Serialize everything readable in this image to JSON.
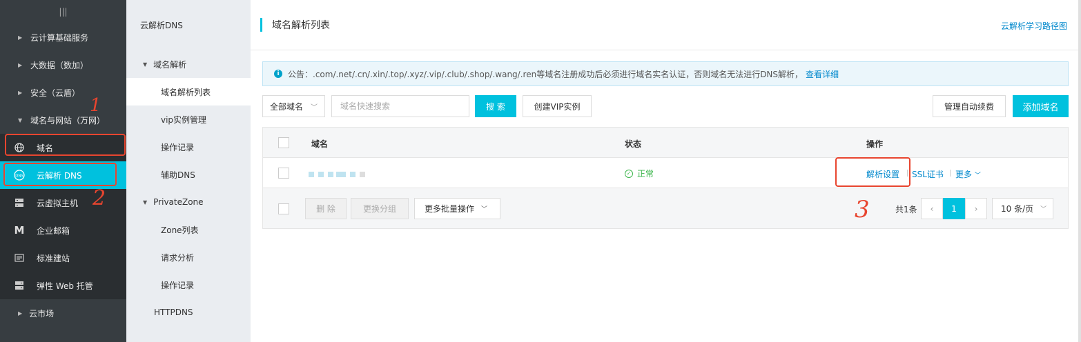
{
  "nav": {
    "top_icon": "|||",
    "groups": [
      {
        "label": "云计算基础服务"
      },
      {
        "label": "大数据（数加）"
      },
      {
        "label": "安全（云盾）"
      },
      {
        "label": "域名与网站（万网）"
      }
    ],
    "sub_items": [
      {
        "label": "域名",
        "icon": "globe-icon"
      },
      {
        "label": "云解析 DNS",
        "icon": "dns-icon"
      },
      {
        "label": "云虚拟主机",
        "icon": "server-icon"
      },
      {
        "label": "企业邮箱",
        "icon": "mail-icon"
      },
      {
        "label": "标准建站",
        "icon": "site-icon"
      },
      {
        "label": "弹性 Web 托管",
        "icon": "web-host-icon"
      }
    ],
    "last_group": "云市场"
  },
  "subnav": {
    "title": "云解析DNS",
    "group1": "域名解析",
    "group1_items": [
      "域名解析列表",
      "vip实例管理",
      "操作记录",
      "辅助DNS"
    ],
    "group2": "PrivateZone",
    "group2_items": [
      "Zone列表",
      "请求分析",
      "操作记录"
    ],
    "plain": "HTTPDNS"
  },
  "header": {
    "title": "域名解析列表",
    "link": "云解析学习路径图"
  },
  "notice": {
    "text": "公告：.com/.net/.cn/.xin/.top/.xyz/.vip/.club/.shop/.wang/.ren等域名注册成功后必须进行域名实名认证，否则域名无法进行DNS解析，",
    "more": "查看详细"
  },
  "toolbar": {
    "select_value": "全部域名",
    "search_placeholder": "域名快速搜索",
    "search_button": "搜 索",
    "create_vip": "创建VIP实例",
    "auto_renew": "管理自动续费",
    "add_domain": "添加域名"
  },
  "table": {
    "headers": {
      "domain": "域名",
      "status": "状态",
      "actions": "操作"
    },
    "row": {
      "status": "正常",
      "actions": [
        "解析设置",
        "SSL证书",
        "更多"
      ]
    },
    "footer": {
      "delete": "删 除",
      "change_group": "更换分组",
      "batch": "更多批量操作",
      "total": "共1条",
      "page": "1",
      "page_size": "10 条/页"
    }
  },
  "annotations": [
    "1",
    "2",
    "3"
  ],
  "colors": {
    "accent": "#00c1de",
    "link": "#0088cc",
    "annotation": "#e8452f"
  }
}
